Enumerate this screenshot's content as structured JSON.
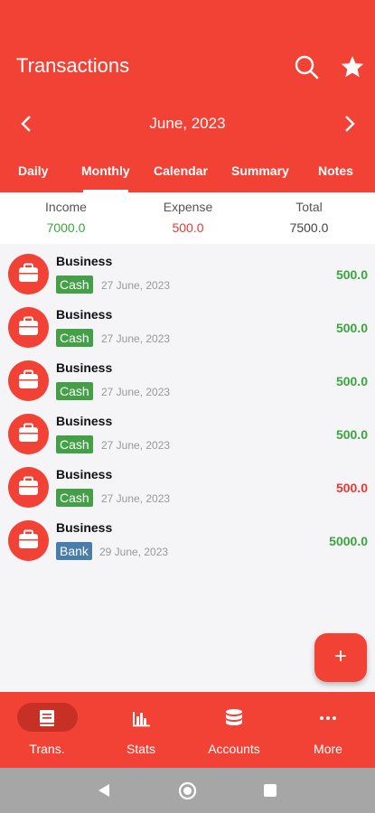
{
  "header": {
    "title": "Transactions",
    "month": "June, 2023",
    "icons": [
      "search-icon",
      "star-icon",
      "chevron-left-icon",
      "chevron-right-icon"
    ]
  },
  "tabs": [
    "Daily",
    "Monthly",
    "Calendar",
    "Summary",
    "Notes"
  ],
  "active_tab": "Monthly",
  "summary": {
    "income_label": "Income",
    "income_value": "7000.0",
    "expense_label": "Expense",
    "expense_value": "500.0",
    "total_label": "Total",
    "total_value": "7500.0"
  },
  "transactions": [
    {
      "title": "Business",
      "account": "Cash",
      "date": "27 June, 2023",
      "amount": "500.0",
      "type": "income"
    },
    {
      "title": "Business",
      "account": "Cash",
      "date": "27 June, 2023",
      "amount": "500.0",
      "type": "income"
    },
    {
      "title": "Business",
      "account": "Cash",
      "date": "27 June, 2023",
      "amount": "500.0",
      "type": "income"
    },
    {
      "title": "Business",
      "account": "Cash",
      "date": "27 June, 2023",
      "amount": "500.0",
      "type": "income"
    },
    {
      "title": "Business",
      "account": "Cash",
      "date": "27 June, 2023",
      "amount": "500.0",
      "type": "expense"
    },
    {
      "title": "Business",
      "account": "Bank",
      "date": "29 June, 2023",
      "amount": "5000.0",
      "type": "income"
    }
  ],
  "fab": {
    "label": "+"
  },
  "bottom_nav": [
    {
      "label": "Trans.",
      "icon": "book-icon",
      "active": true
    },
    {
      "label": "Stats",
      "icon": "bar-chart-icon",
      "active": false
    },
    {
      "label": "Accounts",
      "icon": "database-icon",
      "active": false
    },
    {
      "label": "More",
      "icon": "more-dots-icon",
      "active": false
    }
  ],
  "colors": {
    "primary": "#f24236",
    "income": "#3aa53f",
    "expense": "#e53935",
    "cash_badge": "#43a047",
    "bank_badge": "#4a7eaa"
  }
}
